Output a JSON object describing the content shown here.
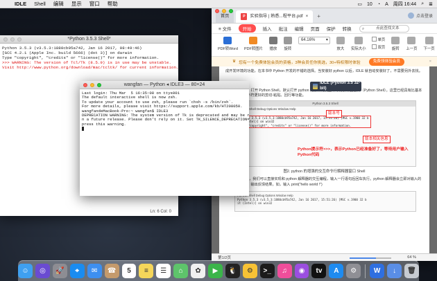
{
  "menubar": {
    "apple": "",
    "items": [
      "IDLE",
      "Shell",
      "编辑",
      "显示",
      "窗口",
      "帮助"
    ],
    "battery": "10",
    "clock": "周四 16:44",
    "lang": "A"
  },
  "shell": {
    "title": "*Python 3.5.3 Shell*",
    "lines": [
      "Python 3.5.3 (v3.5.3:1880cb95a742, Jan 16 2017, 08:49:46)",
      "[GCC 4.2.1 (Apple Inc. build 5666) (dot 3)] on darwin",
      "Type \"copyright\", \"credits\" or \"license()\" for more information."
    ],
    "warning": ">>> WARNING: The version of Tcl/Tk (8.5.9) is in use may be unstable.",
    "visit": "Visit http://www.python.org/download/mac/tcltk/ for current information.",
    "status": "Ln: 6  Col: 0"
  },
  "terminal": {
    "title": "wangfan — Python ◂ IDLE3 — 80×24",
    "lines": [
      "Last login: Thu Mar  5 16:35:08 on ttys001",
      "",
      "The default interactive shell is now zsh.",
      "To update your account to use zsh, please run `chsh -s /bin/zsh`.",
      "For more details, please visit https://support.apple.com/kb/HT208050.",
      "wangfandeMacBook-Pro:~ wangfan$ IDLE3",
      "DEPRECATION WARNING: The system version of Tk is deprecated and may be removed i",
      "n a future release. Please don't rely on it. Set TK_SILENCE_DEPRECATION=1 to sup",
      "press this warning."
    ]
  },
  "pdf": {
    "tab_home": "首页",
    "tab_active": "实验指导 | 熟悉...程平台.pdf",
    "tab_plus": "+",
    "user": "点击登录",
    "menu": [
      "≡ 文件",
      "开始",
      "插入",
      "批注",
      "编辑",
      "页面",
      "保护",
      "转换"
    ],
    "search": "点此查找文本",
    "tools": [
      {
        "label": "PDF转Word",
        "color": "#2b6fd6"
      },
      {
        "label": "PDF转图片",
        "color": "#f08a24"
      },
      {
        "label": "播放",
        "color": "#666"
      },
      {
        "label": "旋转",
        "color": "#666"
      }
    ],
    "zoom": "64.16%",
    "tools2": [
      {
        "label": "放大",
        "color": "#888"
      },
      {
        "label": "实际大小",
        "color": "#888"
      }
    ],
    "checks": [
      "单页",
      "双页",
      "连续阅读"
    ],
    "tools3": [
      {
        "label": "旋转",
        "color": "#888"
      },
      {
        "label": "上一页",
        "color": "#888"
      },
      {
        "label": "下一页",
        "color": "#888"
      }
    ],
    "notice": "您有一个免费体验会员的资格，3种会员任你挑选，30+特权限时体验",
    "notice_btn": "免费领体验会员",
    "page": {
      "para1": "成开发环境的功能，在本书中 Python 开发的不错的选择。当安装好 python 以后，IDLE 就自动安装好了，不需要另外去找。",
      "para2": "2）点击 IDLE，打开 Python Shell，默认打开 python 的解释的交互命令行解释器窗口（Python Shell）。这里已经具有比基本的交互命令提示符更好的剪切-粘贴、回行等功能。",
      "idle_popup": "IDLE (Python 3.5 32-bit)",
      "ann_title": "版本号",
      "ann_version": "版本相关信息",
      "ann_prompt": "Python提示符>>>，表示Python已经准备好了，等待用户输入Python代码",
      "shot_lines": [
        "Python 3.5.3 (v3.5.3:1880cb95a742, Jan 16 2017, 15:51:26) [MSC v.1900 32 b",
        "it (Intel)] on win32",
        "Type \"copyright\", \"credits\" or \"license()\" for more information."
      ],
      "shot_prompt": ">>> |",
      "caption": "图2. python 的增强的交互命令行解释器窗口 Shell",
      "para3": "3）通过该窗口，我们可以直接实现和 python 解释器的交互编程，输入一行语句后回车执行。python 解释器会立即对输入的语句进行处理，输出反馈结果。如，输入 print(\"hello world !\")",
      "shot2_lines": [
        "Python 3.5.3 (v3.5.3:1880cb95a742, Jan 16 2017, 15:51:26) [MSC v.1900 32 b",
        "it (Intel)] on win32"
      ]
    },
    "status_page": "第1/2页",
    "status_zoom": "64 %"
  },
  "dock": [
    {
      "name": "finder",
      "glyph": "☺",
      "color": "#3fa0f0"
    },
    {
      "name": "siri",
      "glyph": "◎",
      "color": "#6a4bd1"
    },
    {
      "name": "launchpad",
      "glyph": "🚀",
      "color": "#8d8d93"
    },
    {
      "name": "safari",
      "glyph": "⌖",
      "color": "#1a8cf0"
    },
    {
      "name": "mail",
      "glyph": "✉",
      "color": "#3d8ff0"
    },
    {
      "name": "contacts",
      "glyph": "☎",
      "color": "#c49a6c"
    },
    {
      "name": "calendar",
      "glyph": "5",
      "color": "#ffffff"
    },
    {
      "name": "notes",
      "glyph": "≡",
      "color": "#f5d65a"
    },
    {
      "name": "reminders",
      "glyph": "☰",
      "color": "#ffffff"
    },
    {
      "name": "maps",
      "glyph": "⌂",
      "color": "#5ec46b"
    },
    {
      "name": "photos",
      "glyph": "✿",
      "color": "#f0f0f0"
    },
    {
      "name": "facetime",
      "glyph": "▶",
      "color": "#3bb54a"
    },
    {
      "name": "qq",
      "glyph": "🐧",
      "color": "#222"
    },
    {
      "name": "idle",
      "glyph": "⚙",
      "color": "#f7c235"
    },
    {
      "name": "terminal",
      "glyph": ">_",
      "color": "#1b1b1b"
    },
    {
      "name": "itunes",
      "glyph": "♫",
      "color": "#f04e9b"
    },
    {
      "name": "podcasts",
      "glyph": "◉",
      "color": "#9b4ee0"
    },
    {
      "name": "appletv",
      "glyph": "tv",
      "color": "#111"
    },
    {
      "name": "appstore",
      "glyph": "A",
      "color": "#1e8bf0"
    },
    {
      "name": "preferences",
      "glyph": "⚙",
      "color": "#8f8f95"
    },
    {
      "name": "wps",
      "glyph": "W",
      "color": "#2f6fe0"
    },
    {
      "name": "downloads",
      "glyph": "↓",
      "color": "#5a8ee6"
    },
    {
      "name": "trash",
      "glyph": "🗑",
      "color": "#c7cbd1"
    }
  ]
}
